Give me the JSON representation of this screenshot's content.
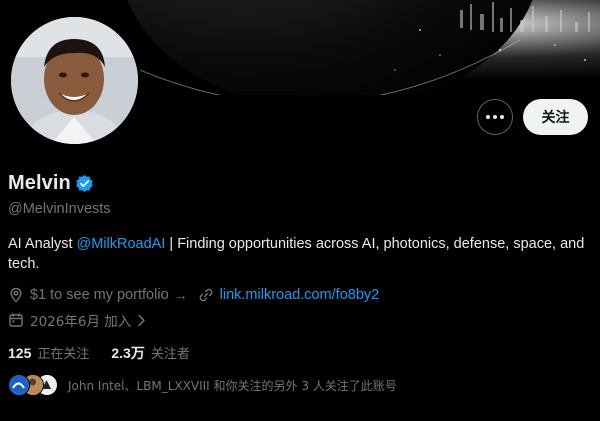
{
  "profile": {
    "display_name": "Melvin",
    "handle": "@MelvinInvests",
    "bio_prefix": "AI Analyst ",
    "bio_mention": "@MilkRoadAI",
    "bio_suffix": " | Finding opportunities across AI, photonics, defense, space, and tech.",
    "location": "$1 to see my portfolio",
    "location_arrow": "→",
    "website": "link.milkroad.com/fo8by2",
    "joined": "2026年6月 加入"
  },
  "actions": {
    "follow_label": "关注"
  },
  "stats": {
    "following_count": "125",
    "following_label": "正在关注",
    "followers_count": "2.3万",
    "followers_label": "关注者"
  },
  "followers_you_know": {
    "text": "John Intel、LBM_LXXVIII 和你关注的另外 3 人关注了此账号"
  },
  "colors": {
    "accent": "#1d9bf0",
    "text_primary": "#e7e9ea",
    "text_secondary": "#71767b",
    "background": "#000000"
  },
  "icons": {
    "more": "more-icon",
    "verified": "verified-badge-icon",
    "location": "location-pin-icon",
    "link": "link-icon",
    "calendar": "calendar-icon",
    "chevron": "chevron-right-icon"
  }
}
